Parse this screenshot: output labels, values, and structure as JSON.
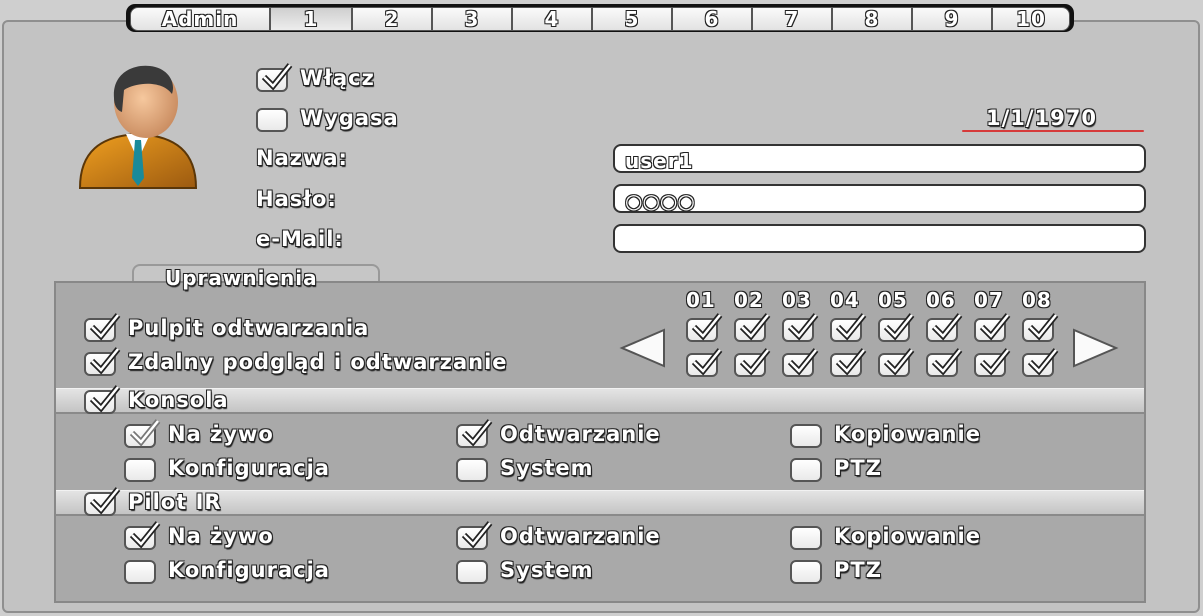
{
  "tabs": [
    "Admin",
    "1",
    "2",
    "3",
    "4",
    "5",
    "6",
    "7",
    "8",
    "9",
    "10"
  ],
  "active_tab": "1",
  "user": {
    "enable_label": "Włącz",
    "enable_checked": true,
    "expire_label": "Wygasa",
    "expire_checked": false,
    "expire_date": "1/1/1970",
    "name_label": "Nazwa:",
    "name_value": "user1",
    "password_label": "Hasło:",
    "password_value": "○○○○",
    "email_label": "e-Mail:",
    "email_value": ""
  },
  "permissions": {
    "title": "Uprawnienia",
    "playback_desk_label": "Pulpit odtwarzania",
    "playback_desk_checked": true,
    "remote_label": "Zdalny podgląd i odtwarzanie",
    "remote_checked": true,
    "channels": [
      "01",
      "02",
      "03",
      "04",
      "05",
      "06",
      "07",
      "08"
    ],
    "channels_row1": [
      true,
      true,
      true,
      true,
      true,
      true,
      true,
      true
    ],
    "channels_row2": [
      true,
      true,
      true,
      true,
      true,
      true,
      true,
      true
    ],
    "console": {
      "label": "Konsola",
      "checked": true,
      "live_label": "Na żywo",
      "live_checked": true,
      "playback_label": "Odtwarzanie",
      "playback_checked": true,
      "backup_label": "Kopiowanie",
      "backup_checked": false,
      "config_label": "Konfiguracja",
      "config_checked": false,
      "system_label": "System",
      "system_checked": false,
      "ptz_label": "PTZ",
      "ptz_checked": false
    },
    "ir": {
      "label": "Pilot IR",
      "checked": true,
      "live_label": "Na żywo",
      "live_checked": true,
      "playback_label": "Odtwarzanie",
      "playback_checked": true,
      "backup_label": "Kopiowanie",
      "backup_checked": false,
      "config_label": "Konfiguracja",
      "config_checked": false,
      "system_label": "System",
      "system_checked": false,
      "ptz_label": "PTZ",
      "ptz_checked": false
    }
  },
  "icons": {
    "avatar": "user-avatar-icon",
    "prev": "arrow-left-icon",
    "next": "arrow-right-icon",
    "check": "checkmark-icon"
  }
}
